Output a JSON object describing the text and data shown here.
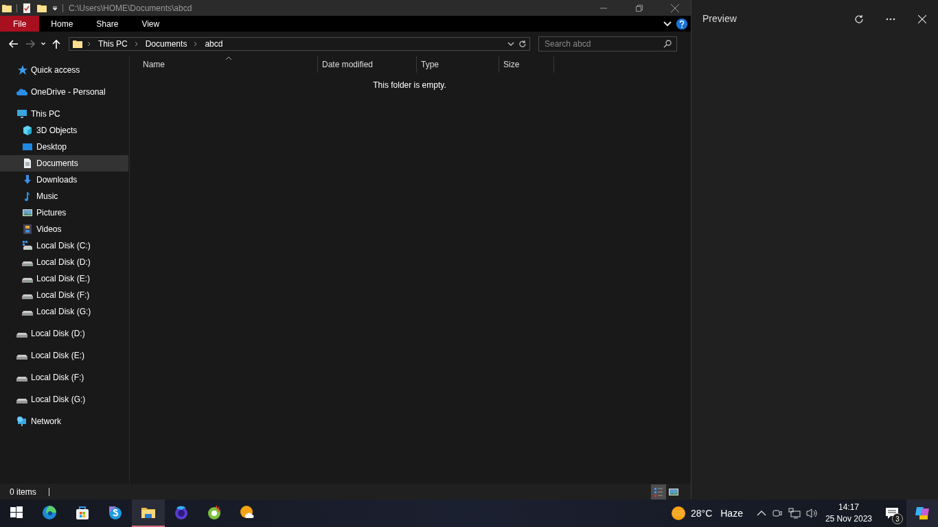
{
  "title_bar": {
    "path": "C:\\Users\\HOME\\Documents\\abcd"
  },
  "ribbon": {
    "tabs": [
      {
        "label": "File",
        "kind": "file"
      },
      {
        "label": "Home",
        "kind": "tab"
      },
      {
        "label": "Share",
        "kind": "tab"
      },
      {
        "label": "View",
        "kind": "tab"
      }
    ]
  },
  "nav_buttons": [
    {
      "kind": "back",
      "disabled": false
    },
    {
      "kind": "forward",
      "disabled": true
    },
    {
      "kind": "recent",
      "disabled": false
    },
    {
      "kind": "up",
      "disabled": false
    }
  ],
  "address": {
    "crumbs": [
      "This PC",
      "Documents",
      "abcd"
    ]
  },
  "search": {
    "placeholder": "Search abcd"
  },
  "nav": [
    {
      "label": "Quick access",
      "kind": "star",
      "selected": false
    },
    {
      "label": "OneDrive - Personal",
      "kind": "cloud",
      "selected": false
    },
    {
      "label": "This PC",
      "kind": "pc",
      "selected": false,
      "children": [
        {
          "label": "3D Objects",
          "kind": "cube",
          "selected": false
        },
        {
          "label": "Desktop",
          "kind": "desktop",
          "selected": false
        },
        {
          "label": "Documents",
          "kind": "document",
          "selected": true
        },
        {
          "label": "Downloads",
          "kind": "download",
          "selected": false
        },
        {
          "label": "Music",
          "kind": "music",
          "selected": false
        },
        {
          "label": "Pictures",
          "kind": "pictures",
          "selected": false
        },
        {
          "label": "Videos",
          "kind": "videos",
          "selected": false
        },
        {
          "label": "Local Disk (C:)",
          "kind": "system-disk",
          "selected": false
        },
        {
          "label": "Local Disk (D:)",
          "kind": "disk",
          "selected": false
        },
        {
          "label": "Local Disk (E:)",
          "kind": "disk",
          "selected": false
        },
        {
          "label": "Local Disk (F:)",
          "kind": "disk",
          "selected": false
        },
        {
          "label": "Local Disk (G:)",
          "kind": "disk",
          "selected": false
        }
      ]
    },
    {
      "label": "Local Disk (D:)",
      "kind": "disk",
      "selected": false
    },
    {
      "label": "Local Disk (E:)",
      "kind": "disk",
      "selected": false
    },
    {
      "label": "Local Disk (F:)",
      "kind": "disk",
      "selected": false
    },
    {
      "label": "Local Disk (G:)",
      "kind": "disk",
      "selected": false
    },
    {
      "label": "Network",
      "kind": "network",
      "selected": false
    }
  ],
  "columns": [
    "Name",
    "Date modified",
    "Type",
    "Size"
  ],
  "empty_message": "This folder is empty.",
  "status_bar": {
    "count": "0 items",
    "views": [
      {
        "kind": "details",
        "selected": true
      },
      {
        "kind": "large-icons",
        "selected": false
      }
    ]
  },
  "preview": {
    "title": "Preview"
  },
  "taskbar": {
    "apps": [
      {
        "kind": "start",
        "selected": false
      },
      {
        "kind": "edge",
        "selected": false
      },
      {
        "kind": "store",
        "selected": false
      },
      {
        "kind": "skype",
        "selected": false
      },
      {
        "kind": "explorer",
        "selected": true
      },
      {
        "kind": "firefox",
        "selected": false
      },
      {
        "kind": "green",
        "selected": false
      },
      {
        "kind": "weather-app",
        "selected": false
      }
    ],
    "weather": {
      "temp": "28°C",
      "condition": "Haze"
    },
    "time": "14:17",
    "date": "25 Nov 2023",
    "notifications": "3"
  }
}
